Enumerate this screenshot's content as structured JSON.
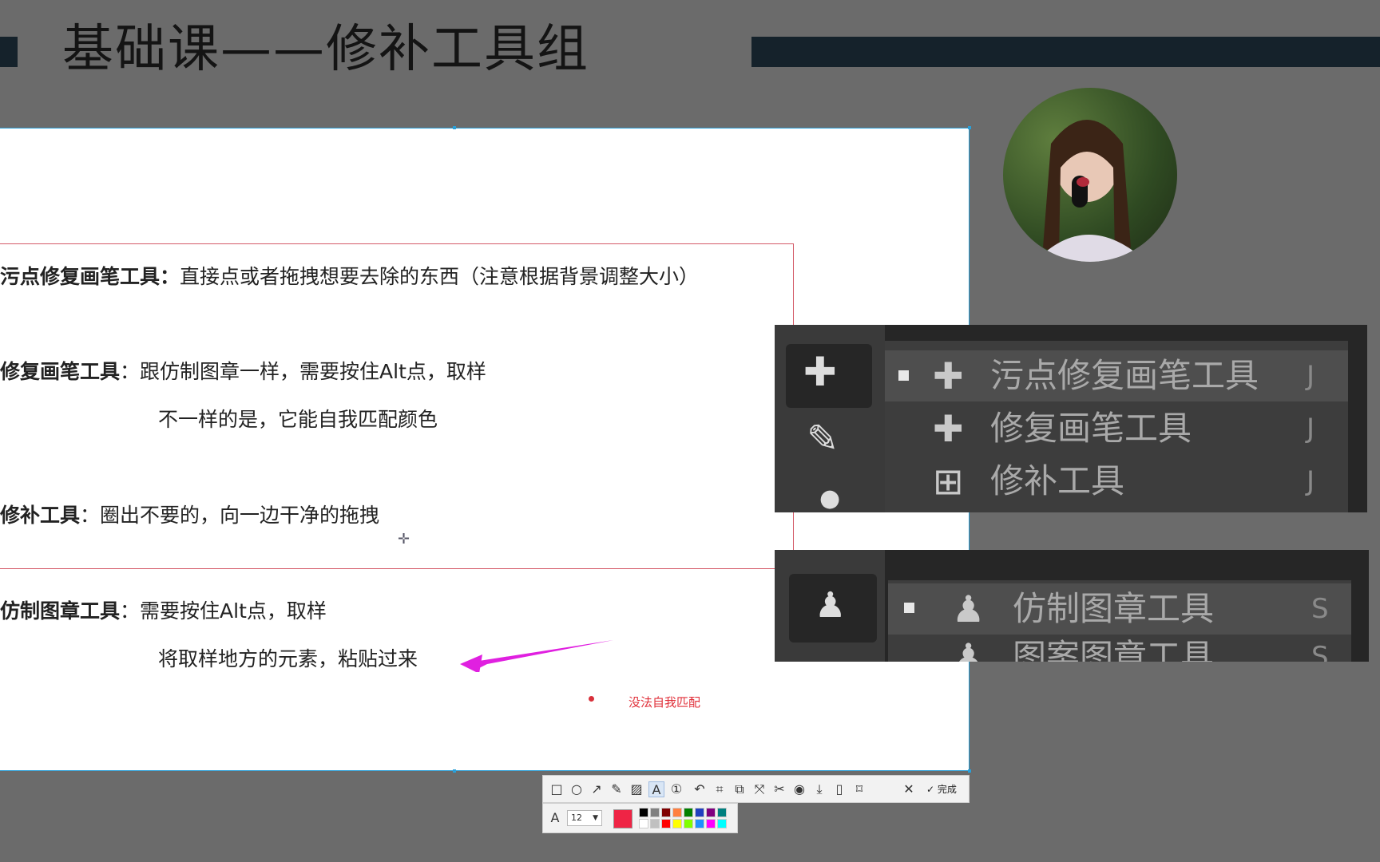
{
  "header": {
    "title": "基础课——修补工具组"
  },
  "slide": {
    "lines": [
      {
        "bold": "污点修复画笔工具：",
        "text": "直接点或者拖拽想要去除的东西（注意根据背景调整大小）"
      },
      {
        "bold": "修复画笔工具",
        "text": "：跟仿制图章一样，需要按住Alt点，取样"
      },
      {
        "bold": "",
        "text": "不一样的是，它能自我匹配颜色"
      },
      {
        "bold": "修补工具",
        "text": "：圈出不要的，向一边干净的拖拽"
      },
      {
        "bold": "仿制图章工具",
        "text": "：需要按住Alt点，取样"
      },
      {
        "bold": "",
        "text": "将取样地方的元素，粘贴过来"
      }
    ],
    "annotation": "没法自我匹配",
    "arrow_color": "#e020e0",
    "annotation_color": "#e0303a"
  },
  "ps_panel_top": {
    "items": [
      {
        "label": "污点修复画笔工具",
        "key": "J",
        "active": true,
        "icon": "spot-healing-brush-icon"
      },
      {
        "label": "修复画笔工具",
        "key": "J",
        "active": false,
        "icon": "healing-brush-icon"
      },
      {
        "label": "修补工具",
        "key": "J",
        "active": false,
        "icon": "patch-tool-icon"
      }
    ]
  },
  "ps_panel_bottom": {
    "items": [
      {
        "label": "仿制图章工具",
        "key": "S",
        "active": true,
        "icon": "clone-stamp-icon"
      },
      {
        "label": "图案图章工具",
        "key": "S",
        "active": false,
        "icon": "pattern-stamp-icon"
      }
    ]
  },
  "screenshot_toolbar": {
    "tools": [
      "rectangle-icon",
      "ellipse-icon",
      "arrow-icon",
      "pen-icon",
      "mosaic-icon",
      "text-icon",
      "number-icon",
      "undo-icon",
      "ocr-icon",
      "pin-icon",
      "scroll-capture-icon",
      "translate-icon",
      "record-icon",
      "download-icon",
      "save-icon",
      "bookmark-icon",
      "close-icon"
    ],
    "done_label": "完成",
    "font_size": "12",
    "current_color": "#ef2445",
    "palette": [
      "#000000",
      "#808080",
      "#800000",
      "#ff8040",
      "#008000",
      "#2040c0",
      "#800080",
      "#008080",
      "#ffffff",
      "#c0c0c0",
      "#ff0000",
      "#ffff00",
      "#80ff00",
      "#2090ff",
      "#ff00ff",
      "#00ffff"
    ]
  }
}
